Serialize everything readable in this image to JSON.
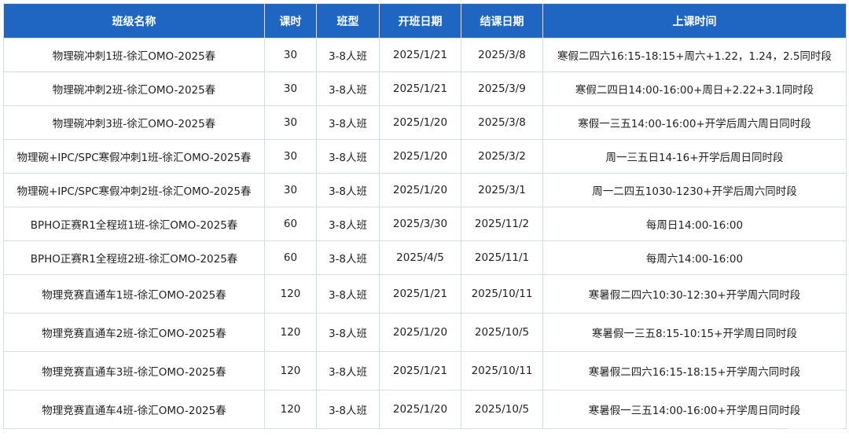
{
  "table": {
    "headers": [
      "班级名称",
      "课时",
      "班型",
      "开班日期",
      "结课日期",
      "上课时间"
    ],
    "rows": [
      [
        "物理碗冲刺1班-徐汇OMO-2025春",
        "30",
        "3-8人班",
        "2025/1/21",
        "2025/3/8",
        "寒假二四六16:15-18:15+周六+1.22，1.24，2.5同时段"
      ],
      [
        "物理碗冲刺2班-徐汇OMO-2025春",
        "30",
        "3-8人班",
        "2025/1/21",
        "2025/3/9",
        "寒假二四日14:00-16:00+周日+2.22+3.1同时段"
      ],
      [
        "物理碗冲刺3班-徐汇OMO-2025春",
        "30",
        "3-8人班",
        "2025/1/20",
        "2025/3/8",
        "寒假一三五14:00-16:00+开学后周六周日同时段"
      ],
      [
        "物理碗+IPC/SPC寒假冲刺1班-徐汇OMO-2025春",
        "30",
        "3-8人班",
        "2025/1/20",
        "2025/3/2",
        "周一三五日14-16+开学后周日同时段"
      ],
      [
        "物理碗+IPC/SPC寒假冲刺2班-徐汇OMO-2025春",
        "30",
        "3-8人班",
        "2025/1/20",
        "2025/3/1",
        "周一二四五1030-1230+开学后周六同时段"
      ],
      [
        "BPHO正赛R1全程班1班-徐汇OMO-2025春",
        "60",
        "3-8人班",
        "2025/3/30",
        "2025/11/2",
        "每周日14:00-16:00"
      ],
      [
        "BPHO正赛R1全程班2班-徐汇OMO-2025春",
        "60",
        "3-8人班",
        "2025/4/5",
        "2025/11/1",
        "每周六14:00-16:00"
      ],
      [
        "物理竞赛直通车1班-徐汇OMO-2025春",
        "120",
        "3-8人班",
        "2025/1/21",
        "2025/10/11",
        "寒暑假二四六10:30-12:30+开学周六同时段"
      ],
      [
        "物理竞赛直通车2班-徐汇OMO-2025春",
        "120",
        "3-8人班",
        "2025/1/20",
        "2025/10/5",
        "寒暑假一三五8:15-10:15+开学周日同时段"
      ],
      [
        "物理竞赛直通车3班-徐汇OMO-2025春",
        "120",
        "3-8人班",
        "2025/1/21",
        "2025/10/11",
        "寒暑假二四六16:15-18:15+开学周六同时段"
      ],
      [
        "物理竞赛直通车4班-徐汇OMO-2025春",
        "120",
        "3-8人班",
        "2025/1/20",
        "2025/10/5",
        "寒暑假一三五14:00-16:00+开学周日同时段"
      ]
    ]
  },
  "colors": {
    "header_bg": "#1f66c2",
    "header_text": "#ffffff",
    "border": "#d6dde8",
    "cell_text": "#222222"
  }
}
